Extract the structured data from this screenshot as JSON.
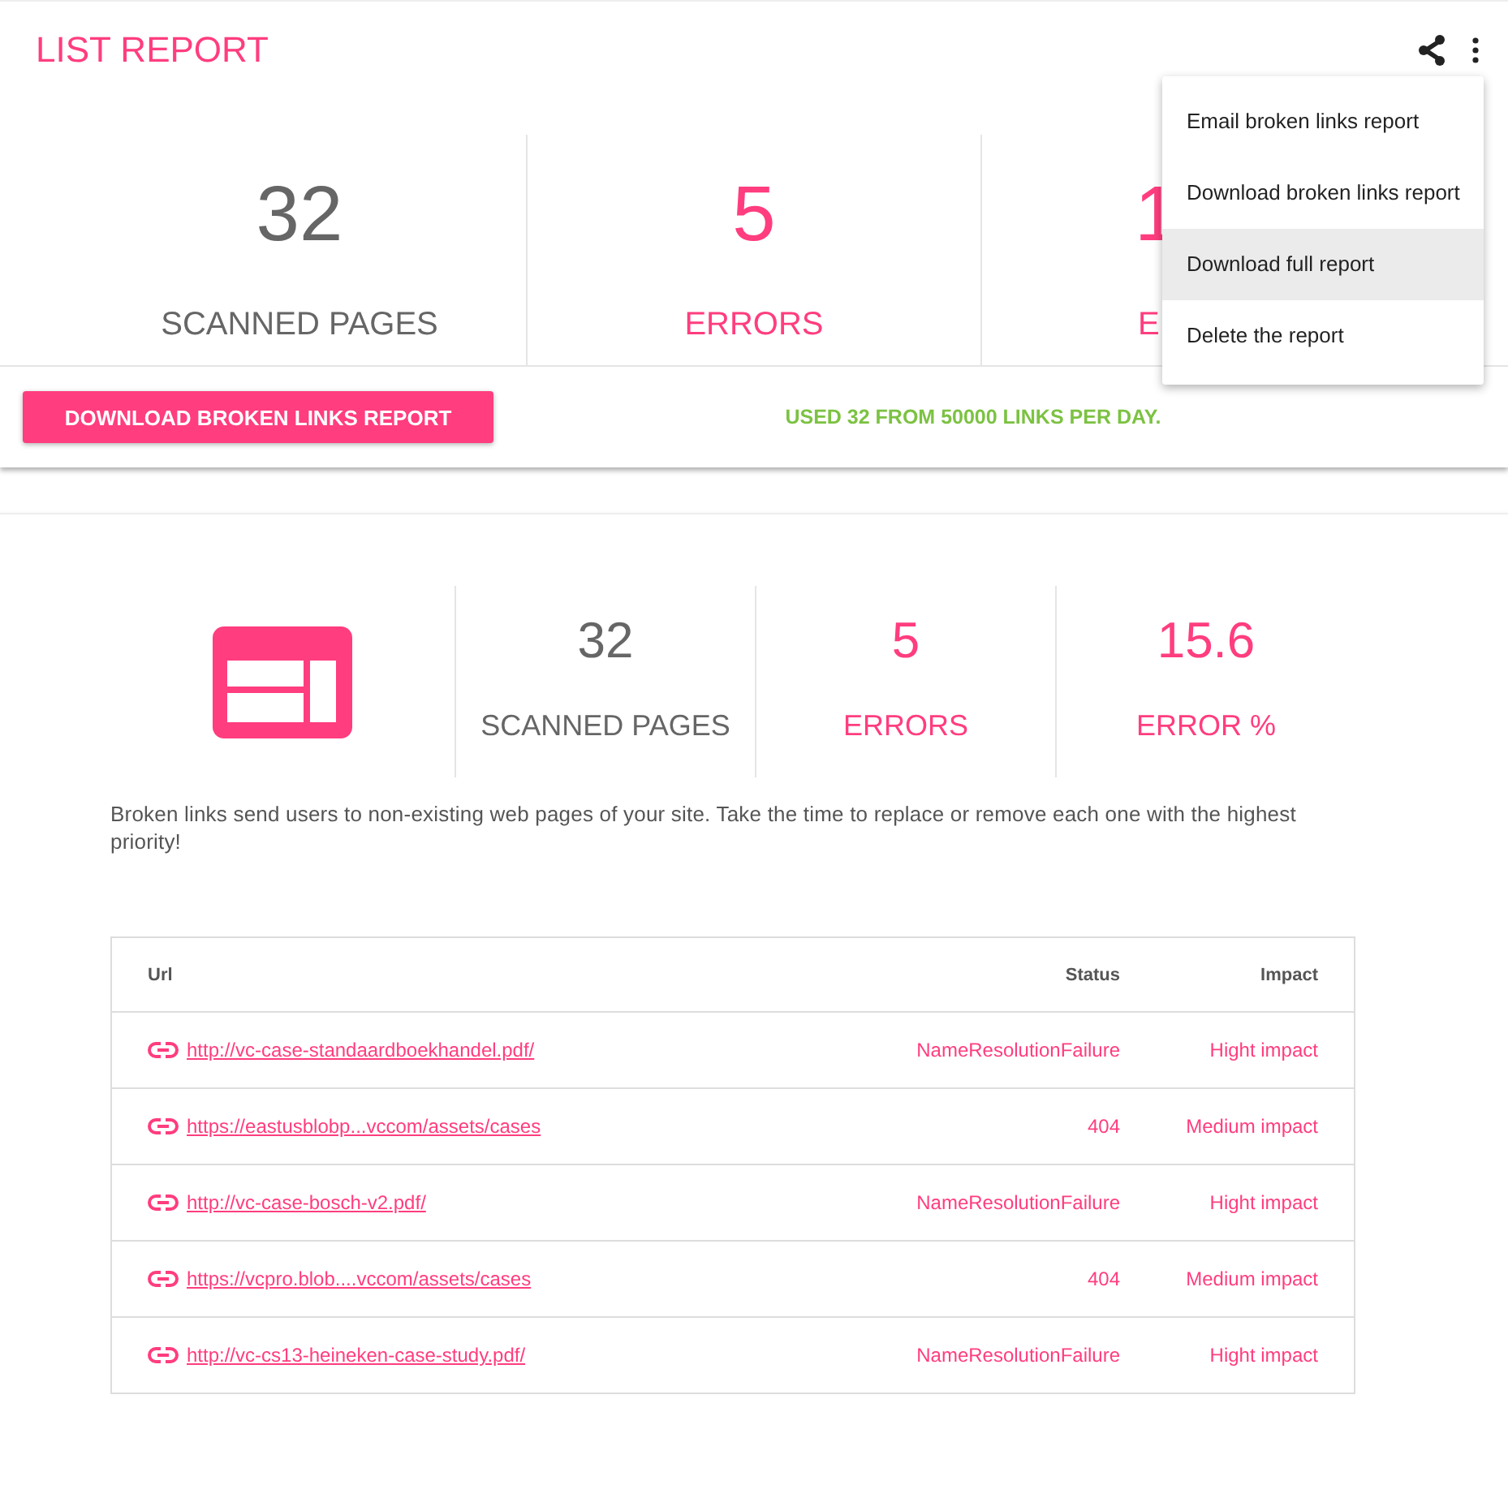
{
  "header": {
    "title": "LIST REPORT"
  },
  "summary_stats": [
    {
      "kind": "neutral",
      "value": "32",
      "label": "SCANNED PAGES"
    },
    {
      "kind": "alert",
      "value": "5",
      "label": "ERRORS"
    },
    {
      "kind": "alert",
      "value": "1",
      "label": "E"
    }
  ],
  "download_button": "DOWNLOAD BROKEN LINKS REPORT",
  "usage_note": "USED 32 FROM 50000 LINKS PER DAY.",
  "menu": [
    {
      "label": "Email broken links report",
      "selected": false
    },
    {
      "label": "Download broken links report",
      "selected": false
    },
    {
      "label": "Download full report",
      "selected": true
    },
    {
      "label": "Delete the report",
      "selected": false
    }
  ],
  "detail_stats": [
    {
      "kind": "neutral",
      "value": "32",
      "label": "SCANNED PAGES"
    },
    {
      "kind": "alert",
      "value": "5",
      "label": "ERRORS"
    },
    {
      "kind": "alert",
      "value": "15.6",
      "label": "ERROR %"
    }
  ],
  "description": "Broken links send users to non-existing web pages of your site. Take the time to replace or remove each one with the highest priority!",
  "table": {
    "columns": [
      "Url",
      "Status",
      "Impact"
    ],
    "rows": [
      {
        "url": "http://vc-case-standaardboekhandel.pdf/",
        "status": "NameResolutionFailure",
        "impact": "Hight impact"
      },
      {
        "url": "https://eastusblobp...vccom/assets/cases",
        "status": "404",
        "impact": "Medium impact"
      },
      {
        "url": "http://vc-case-bosch-v2.pdf/",
        "status": "NameResolutionFailure",
        "impact": "Hight impact"
      },
      {
        "url": "https://vcpro.blob....vccom/assets/cases",
        "status": "404",
        "impact": "Medium impact"
      },
      {
        "url": "http://vc-cs13-heineken-case-study.pdf/",
        "status": "NameResolutionFailure",
        "impact": "Hight impact"
      }
    ]
  }
}
